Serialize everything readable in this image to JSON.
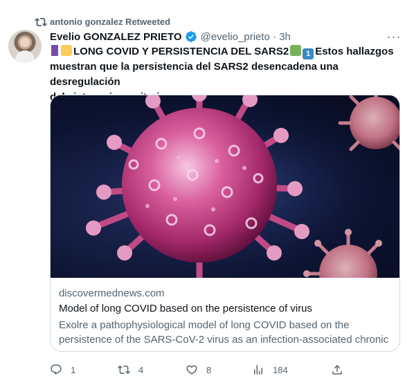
{
  "retweet": {
    "icon": "retweet-icon",
    "text": "antonio gonzalez Retweeted"
  },
  "author": {
    "name": "Evelio GONZALEZ PRIETO",
    "handle": "@evelio_prieto · 3h",
    "verified_icon": "verified-badge-icon",
    "verified_color": "#1d9bf0"
  },
  "tweet": {
    "line1": "LONG COVID Y PERSISTENCIA DEL SARS2",
    "line1_after": "Estos hallazgos",
    "line2": "muestran que la persistencia del SARS2 desencadena una desregulación",
    "line3": "del sistema inmunitario…",
    "emoji_one": "1"
  },
  "card": {
    "domain": "discovermednews.com",
    "title": "Model of long COVID based on the persistence of virus",
    "description": "Exolre a pathophysiological model of long COVID based on the persistence of the SARS-CoV-2 virus as an infection-associated chronic …"
  },
  "actions": {
    "reply": "1",
    "retweet": "4",
    "like": "8",
    "views": "184"
  },
  "colors": {
    "text_primary": "#0f1419",
    "text_secondary": "#536471",
    "border": "#cfd9de"
  }
}
